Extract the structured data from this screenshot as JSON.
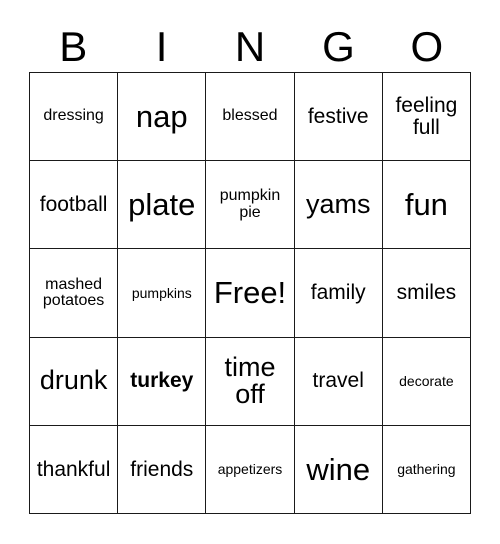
{
  "header": {
    "letters": [
      "B",
      "I",
      "N",
      "G",
      "O"
    ]
  },
  "grid": {
    "rows": 5,
    "columns": 5,
    "border_color": "#1a1a1a",
    "background_color": "#ffffff",
    "text_color": "#000000",
    "cells": [
      [
        {
          "text": "dressing",
          "size": "sm",
          "weight": "normal"
        },
        {
          "text": "nap",
          "size": "xl",
          "weight": "normal"
        },
        {
          "text": "blessed",
          "size": "sm",
          "weight": "normal"
        },
        {
          "text": "festive",
          "size": "md",
          "weight": "normal"
        },
        {
          "text": "feeling full",
          "size": "md",
          "weight": "normal"
        }
      ],
      [
        {
          "text": "football",
          "size": "md",
          "weight": "normal"
        },
        {
          "text": "plate",
          "size": "xl",
          "weight": "normal"
        },
        {
          "text": "pumpkin pie",
          "size": "sm",
          "weight": "normal"
        },
        {
          "text": "yams",
          "size": "lg",
          "weight": "normal"
        },
        {
          "text": "fun",
          "size": "xl",
          "weight": "normal"
        }
      ],
      [
        {
          "text": "mashed potatoes",
          "size": "sm",
          "weight": "normal"
        },
        {
          "text": "pumpkins",
          "size": "xs",
          "weight": "normal"
        },
        {
          "text": "Free!",
          "size": "xl",
          "weight": "normal"
        },
        {
          "text": "family",
          "size": "md",
          "weight": "normal"
        },
        {
          "text": "smiles",
          "size": "md",
          "weight": "normal"
        }
      ],
      [
        {
          "text": "drunk",
          "size": "lg",
          "weight": "normal"
        },
        {
          "text": "turkey",
          "size": "md",
          "weight": "bold"
        },
        {
          "text": "time off",
          "size": "lg",
          "weight": "normal"
        },
        {
          "text": "travel",
          "size": "md",
          "weight": "normal"
        },
        {
          "text": "decorate",
          "size": "xs",
          "weight": "normal"
        }
      ],
      [
        {
          "text": "thankful",
          "size": "md",
          "weight": "normal"
        },
        {
          "text": "friends",
          "size": "md",
          "weight": "normal"
        },
        {
          "text": "appetizers",
          "size": "xs",
          "weight": "normal"
        },
        {
          "text": "wine",
          "size": "xl",
          "weight": "normal"
        },
        {
          "text": "gathering",
          "size": "xs",
          "weight": "normal"
        }
      ]
    ]
  }
}
